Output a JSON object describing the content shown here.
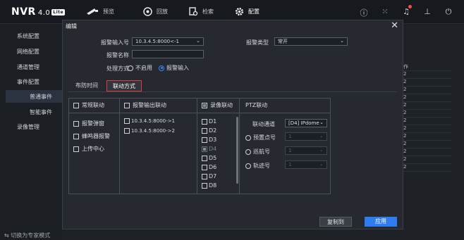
{
  "app": {
    "brand": "NVR",
    "version": "4.0",
    "edition": "Lite"
  },
  "nav": {
    "items": [
      {
        "icon": "camera-icon",
        "label": "预览"
      },
      {
        "icon": "playback-icon",
        "label": "回放"
      },
      {
        "icon": "search-icon",
        "label": "检索"
      },
      {
        "icon": "gear-icon",
        "label": "配置"
      }
    ]
  },
  "topright": {
    "icons": [
      "info-icon",
      "grid-icon",
      "bell-icon",
      "export-icon",
      "power-icon"
    ]
  },
  "sidebar": {
    "items": [
      {
        "label": "系统配置"
      },
      {
        "label": "网络配置"
      },
      {
        "label": "通道管理"
      },
      {
        "label": "事件配置"
      },
      {
        "label": "普通事件",
        "sub": true,
        "active": true
      },
      {
        "label": "智能事件",
        "sub": true
      },
      {
        "label": "录像管理"
      }
    ]
  },
  "background_table": {
    "header": "作",
    "rows": [
      "2",
      "2",
      "2",
      "2",
      "2",
      "2",
      "2",
      "2",
      "2",
      "2",
      "2",
      "2",
      "2"
    ]
  },
  "dialog": {
    "title": "编辑",
    "input_label": "报警输入号",
    "input_value": "10.3.4.5:8000<-1",
    "type_label": "报警类型",
    "type_value": "常开",
    "name_label": "报警名称",
    "name_value": "",
    "handle_label": "处理方式",
    "handle_options": [
      {
        "label": "不启用",
        "selected": false
      },
      {
        "label": "报警输入",
        "selected": true
      }
    ],
    "tabs": [
      {
        "label": "布防时间",
        "active": false
      },
      {
        "label": "联动方式",
        "active": true
      }
    ],
    "link": {
      "regular": {
        "header": "常规联动",
        "options": [
          "报警弹窗",
          "蜂鸣器报警",
          "上传中心"
        ]
      },
      "alarm_out": {
        "header": "报警输出联动",
        "options": [
          "10.3.4.5:8000->1",
          "10.3.4.5:8000->2"
        ]
      },
      "record": {
        "header": "录像联动",
        "channels": [
          {
            "label": "D1",
            "checked": false,
            "disabled": false
          },
          {
            "label": "D2",
            "checked": false,
            "disabled": false
          },
          {
            "label": "D3",
            "checked": false,
            "disabled": false
          },
          {
            "label": "D4",
            "checked": true,
            "disabled": true
          },
          {
            "label": "D5",
            "checked": false,
            "disabled": false
          },
          {
            "label": "D6",
            "checked": false,
            "disabled": false
          },
          {
            "label": "D7",
            "checked": false,
            "disabled": false
          },
          {
            "label": "D8",
            "checked": false,
            "disabled": false
          }
        ]
      },
      "ptz": {
        "header": "PTZ联动",
        "channel_label": "联动通道",
        "channel_value": "[D4] IPdome",
        "options": [
          {
            "label": "预置点号",
            "value": "1"
          },
          {
            "label": "巡航号",
            "value": "1"
          },
          {
            "label": "轨迹号",
            "value": "1"
          }
        ]
      }
    },
    "buttons": {
      "copy": "复制到",
      "apply": "应用"
    }
  },
  "bottom_hint": "切换为专家模式"
}
